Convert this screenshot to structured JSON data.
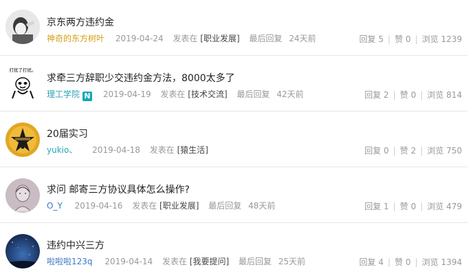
{
  "threads": [
    {
      "title": "京东两方违约金",
      "author": "神奇的东方树叶",
      "date": "2019-04-24",
      "posted_in_label": "发表在",
      "category": "[职业发展]",
      "last_reply_label": "最后回复",
      "last_reply": "24天前",
      "reply_label": "回复",
      "replies": "5",
      "like_label": "赞",
      "likes": "0",
      "view_label": "浏览",
      "views": "1239",
      "avatar": "meme-man-drinking-icon"
    },
    {
      "title": "求牵三方辞职少交违约金方法，8000太多了",
      "author": "理工学院",
      "badge": "N",
      "date": "2019-04-19",
      "posted_in_label": "发表在",
      "category": "[技术交流]",
      "last_reply_label": "最后回复",
      "last_reply": "42天前",
      "reply_label": "回复",
      "replies": "2",
      "like_label": "赞",
      "likes": "0",
      "view_label": "浏览",
      "views": "814",
      "avatar_caption": "打扰了打扰。",
      "avatar": "panda-meme-icon"
    },
    {
      "title": "20届实习",
      "author": "yukio、",
      "date": "2019-04-18",
      "posted_in_label": "发表在",
      "category": "[猿生活]",
      "reply_label": "回复",
      "replies": "0",
      "like_label": "赞",
      "likes": "2",
      "view_label": "浏览",
      "views": "750",
      "avatar": "star-figure-icon"
    },
    {
      "title": "求问 邮寄三方协议具体怎么操作?",
      "author": "O_Y",
      "date": "2019-04-16",
      "posted_in_label": "发表在",
      "category": "[职业发展]",
      "last_reply_label": "最后回复",
      "last_reply": "48天前",
      "reply_label": "回复",
      "replies": "1",
      "like_label": "赞",
      "likes": "0",
      "view_label": "浏览",
      "views": "479",
      "avatar": "sketch-portrait-icon"
    },
    {
      "title": "违约中兴三方",
      "author": "啦啦啦123q",
      "date": "2019-04-14",
      "posted_in_label": "发表在",
      "category": "[我要提问]",
      "last_reply_label": "最后回复",
      "last_reply": "25天前",
      "reply_label": "回复",
      "replies": "4",
      "like_label": "赞",
      "likes": "0",
      "view_label": "浏览",
      "views": "1394",
      "avatar": "night-sky-icon"
    }
  ],
  "colors": {
    "author_gold": "#d4a017",
    "author_teal": "#2aa3b5",
    "author_blue": "#3c78c8",
    "badge": "#1aa6b7",
    "meta_gray": "#999999"
  }
}
